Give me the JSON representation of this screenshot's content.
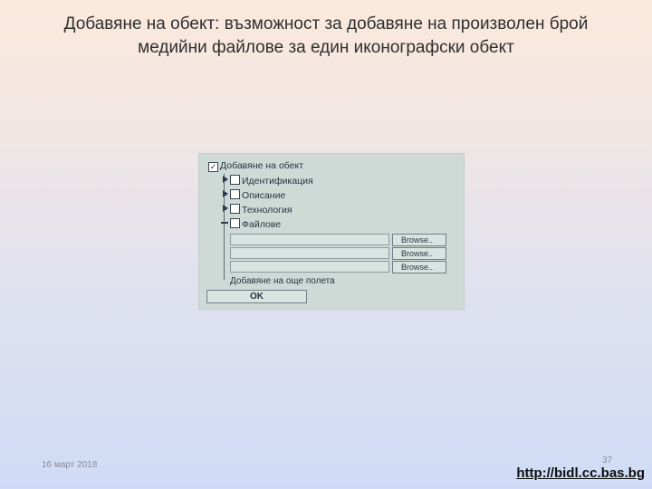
{
  "slide": {
    "title_line1": "Добавяне на обект: възможност за добавяне на произволен брой",
    "title_line2": "медийни файлове за един иконографски обект"
  },
  "form": {
    "add_object": {
      "label": "Добавяне на обект",
      "checked": true,
      "check_glyph": "☑"
    },
    "sections": [
      {
        "label": "Идентификация",
        "checked": false,
        "expander": "collapsed"
      },
      {
        "label": "Описание",
        "checked": false,
        "expander": "collapsed"
      },
      {
        "label": "Технология",
        "checked": false,
        "expander": "collapsed"
      },
      {
        "label": "Файлове",
        "checked": false,
        "expander": "expanded"
      }
    ],
    "files": [
      {
        "value": "",
        "browse_label": "Browse.."
      },
      {
        "value": "",
        "browse_label": "Browse.."
      },
      {
        "value": "",
        "browse_label": "Browse.."
      }
    ],
    "add_more_fields_label": "Добавяне на още полета",
    "ok_label": "OK"
  },
  "footer": {
    "date": "16 март 2018",
    "page_number": "37",
    "link": "http://bidl.cc.bas.bg"
  },
  "colors": {
    "panel_bg": "#cfd9d5",
    "text": "#2a3340"
  }
}
